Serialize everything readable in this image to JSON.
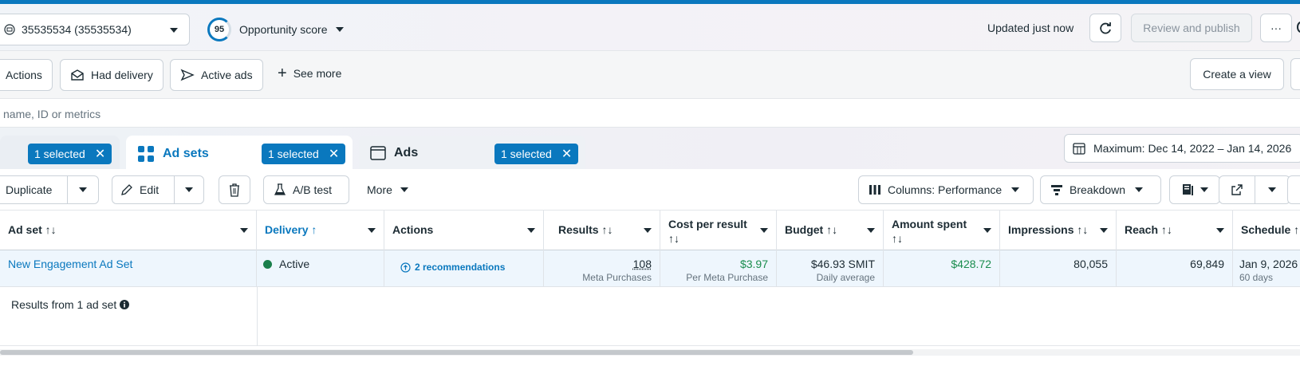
{
  "header": {
    "account": "35535534 (35535534)",
    "opportunity_score": "95",
    "opportunity_label": "Opportunity score",
    "updated": "Updated just now",
    "review_publish": "Review and publish",
    "more": "···"
  },
  "filters": {
    "chips": [
      "Actions",
      "Had delivery",
      "Active ads"
    ],
    "see_more": "See more",
    "create_view": "Create a view"
  },
  "search": {
    "placeholder": "name, ID or metrics"
  },
  "tabs": {
    "campaigns_selected": "1 selected",
    "adsets_label": "Ad sets",
    "adsets_selected": "1 selected",
    "ads_label": "Ads",
    "ads_selected": "1 selected",
    "date_range": "Maximum: Dec 14, 2022 – Jan 14, 2026"
  },
  "toolbar": {
    "duplicate": "Duplicate",
    "edit": "Edit",
    "ab_test": "A/B test",
    "more": "More",
    "columns": "Columns: Performance",
    "breakdown": "Breakdown"
  },
  "table": {
    "headers": {
      "adset": "Ad set ↑↓",
      "delivery": "Delivery ↑",
      "actions": "Actions",
      "results": "Results ↑↓",
      "cpr_line1": "Cost per result",
      "cpr_line2": "↑↓",
      "budget": "Budget ↑↓",
      "spent_line1": "Amount spent",
      "spent_line2": "↑↓",
      "impressions": "Impressions ↑↓",
      "reach": "Reach ↑↓",
      "schedule": "Schedule ↑↓"
    },
    "row": {
      "name": "New Engagement Ad Set",
      "delivery": "Active",
      "recommendations": "2 recommendations",
      "results": "108",
      "results_sub": "Meta Purchases",
      "cpr": "$3.97",
      "cpr_sub": "Per Meta Purchase",
      "budget": "$46.93 SMIT",
      "budget_sub": "Daily average",
      "spent": "$428.72",
      "impressions": "80,055",
      "reach": "69,849",
      "schedule": "Jan 9, 2026",
      "schedule_sub": "60 days"
    },
    "summary": "Results from 1 ad set"
  },
  "colors": {
    "accent": "#0a78be",
    "active": "#1a7f4b",
    "money": "#1a8d4e"
  }
}
